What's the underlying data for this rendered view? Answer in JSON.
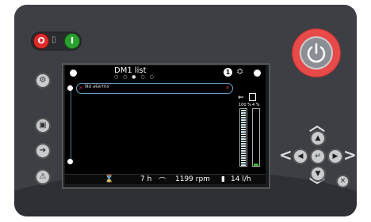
{
  "screen": {
    "title": "DM1 list",
    "page_dots": "○ ○ ● ○ ○",
    "alarm_text": "No alarms",
    "alarm_left_x": "×",
    "alarm_right_x": "×",
    "info_badge": "1",
    "gauge_left_label": "100 %",
    "gauge_right_label": "4 %",
    "gauge_left_level": 1.0,
    "gauge_right_level": 0.04
  },
  "status_bar": {
    "hours": "7 h",
    "rpm": "1199 rpm",
    "fuel_rate": "14 l/h"
  },
  "controller": {
    "stop_label": "O",
    "start_label": "I",
    "enter_label": "↵",
    "close_label": "×"
  },
  "colors": {
    "panel": "#3d3f44",
    "power_ring": "#e84a4a",
    "stop": "#e02b2b",
    "start": "#2aa12f",
    "alarm_border": "#6da3c9",
    "fuel_bar": "#cfe6ee",
    "gauge_green": "#3fbf3f"
  }
}
